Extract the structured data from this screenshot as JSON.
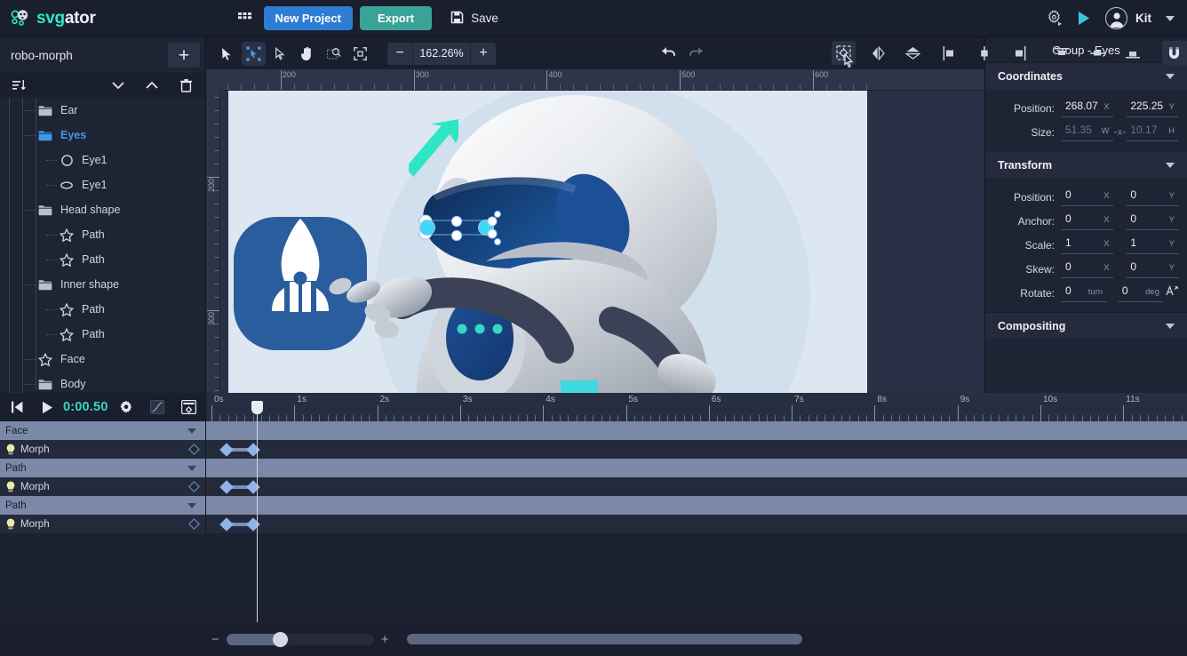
{
  "app": {
    "logo_first": "svg",
    "logo_second": "ator"
  },
  "header": {
    "grid_icon": "apps-grid-icon",
    "new_project_label": "New Project",
    "export_label": "Export",
    "save_label": "Save",
    "save_icon": "floppy-disk-icon",
    "settings_icon": "animation-settings-icon",
    "preview_icon": "play-preview-icon",
    "avatar_icon": "user-avatar-icon",
    "user_name": "Kit",
    "caret_icon": "chevron-down-icon"
  },
  "left_panel": {
    "project_name": "robo-morph",
    "add_label": "+",
    "tools": [
      {
        "name": "sort-layers-icon"
      },
      {
        "name": "collapse-down-icon"
      },
      {
        "name": "collapse-up-icon"
      },
      {
        "name": "delete-layer-icon"
      }
    ],
    "layers": [
      {
        "label": "Ear",
        "icon": "folder-icon",
        "depth": 2,
        "selected": false
      },
      {
        "label": "Eyes",
        "icon": "folder-icon",
        "depth": 2,
        "selected": true
      },
      {
        "label": "Eye1",
        "icon": "circle-icon",
        "depth": 3,
        "selected": false
      },
      {
        "label": "Eye1",
        "icon": "ellipse-icon",
        "depth": 3,
        "selected": false
      },
      {
        "label": "Head shape",
        "icon": "folder-icon",
        "depth": 2,
        "selected": false
      },
      {
        "label": "Path",
        "icon": "path-icon",
        "depth": 3,
        "selected": false
      },
      {
        "label": "Path",
        "icon": "path-icon",
        "depth": 3,
        "selected": false
      },
      {
        "label": "Inner shape",
        "icon": "folder-icon",
        "depth": 2,
        "selected": false
      },
      {
        "label": "Path",
        "icon": "path-icon",
        "depth": 3,
        "selected": false
      },
      {
        "label": "Path",
        "icon": "path-icon",
        "depth": 3,
        "selected": false
      },
      {
        "label": "Face",
        "icon": "path-icon",
        "depth": 2,
        "selected": false
      },
      {
        "label": "Body",
        "icon": "folder-icon",
        "depth": 2,
        "selected": false
      }
    ]
  },
  "toolbar": {
    "tools": [
      {
        "name": "select-tool",
        "active": false
      },
      {
        "name": "node-edit-tool",
        "active": true
      },
      {
        "name": "direct-select-tool",
        "active": false
      },
      {
        "name": "hand-tool",
        "active": false
      },
      {
        "name": "zoom-tool",
        "active": false
      },
      {
        "name": "fit-to-screen-tool",
        "active": false
      }
    ],
    "zoom_minus": "−",
    "zoom_value": "162.26%",
    "zoom_plus": "+",
    "undo_icon": "undo-icon",
    "redo_icon": "redo-icon",
    "right_tools": [
      {
        "name": "transform-center-icon",
        "active": true,
        "hover": true
      },
      {
        "name": "flip-horizontal-icon",
        "active": false
      },
      {
        "name": "flip-vertical-icon",
        "active": false
      },
      {
        "name": "align-left-icon",
        "active": false
      },
      {
        "name": "align-center-h-icon",
        "active": false
      },
      {
        "name": "align-right-icon",
        "active": false
      },
      {
        "name": "align-top-icon",
        "active": false
      },
      {
        "name": "align-middle-v-icon",
        "active": false
      },
      {
        "name": "align-bottom-icon",
        "active": false
      }
    ],
    "snap_icon": "magnet-snap-icon",
    "grid_icon": "grid-icon",
    "guides_icon": "guides-icon",
    "dropdown_icon": "chevron-down-icon"
  },
  "canvas": {
    "ruler_h_labels": [
      "200",
      "300",
      "400",
      "500",
      "600"
    ],
    "ruler_v_labels": [
      "200",
      "300"
    ],
    "cursor_icon": "arrow-pointer-annotation"
  },
  "properties": {
    "title": "Group - Eyes",
    "sections": [
      {
        "name": "Coordinates",
        "label": "Coordinates"
      },
      {
        "name": "Transform",
        "label": "Transform"
      },
      {
        "name": "Compositing",
        "label": "Compositing"
      }
    ],
    "coordinates": {
      "position_label": "Position:",
      "position_x": "268.07",
      "position_x_unit": "X",
      "position_y": "225.25",
      "position_y_unit": "Y",
      "size_label": "Size:",
      "size_w": "51.35",
      "size_w_unit": "W",
      "size_h": "10.17",
      "size_h_unit": "H",
      "link_icon": "link-ratio-icon"
    },
    "transform": {
      "rows": [
        {
          "label": "Position:",
          "x": "0",
          "xunit": "X",
          "y": "0",
          "yunit": "Y"
        },
        {
          "label": "Anchor:",
          "x": "0",
          "xunit": "X",
          "y": "0",
          "yunit": "Y"
        },
        {
          "label": "Scale:",
          "x": "1",
          "xunit": "X",
          "y": "1",
          "yunit": "Y"
        },
        {
          "label": "Skew:",
          "x": "0",
          "xunit": "X",
          "y": "0",
          "yunit": "Y"
        },
        {
          "label": "Rotate:",
          "x": "0",
          "xunit": "turn",
          "y": "0",
          "yunit": "deg"
        }
      ],
      "rotate_icon": "rotate-direction-icon"
    }
  },
  "timeline": {
    "controls": {
      "rewind_icon": "skip-to-start-icon",
      "play_icon": "play-icon",
      "time": "0:00.50",
      "settings_icon": "gear-icon",
      "easing_icon": "easing-curve-icon",
      "keyframe_options_icon": "keyframe-options-icon"
    },
    "ruler_labels": [
      "0s",
      "1s",
      "2s",
      "3s",
      "4s",
      "5s",
      "6s",
      "7s",
      "8s",
      "9s",
      "10s",
      "11s"
    ],
    "rows": [
      {
        "type": "group",
        "label": "Face"
      },
      {
        "type": "prop",
        "label": "Morph",
        "keyframes": [
          0.18,
          0.5
        ],
        "icon": "lightbulb-icon"
      },
      {
        "type": "group",
        "label": "Path"
      },
      {
        "type": "prop",
        "label": "Morph",
        "keyframes": [
          0.18,
          0.5
        ],
        "icon": "lightbulb-icon"
      },
      {
        "type": "group",
        "label": "Path"
      },
      {
        "type": "prop",
        "label": "Morph",
        "keyframes": [
          0.18,
          0.5
        ],
        "icon": "lightbulb-icon"
      }
    ],
    "playhead_time": "0:00.50",
    "zoom_minus": "−",
    "zoom_plus": "+"
  },
  "colors": {
    "accent_blue": "#2d7dd2",
    "accent_teal": "#3aa397",
    "logo_teal": "#2ee6c5",
    "time_teal": "#35d6c3",
    "keyframe_blue": "#8fb4e8",
    "group_row": "#7c88a8",
    "panel_bg": "#1e2434",
    "canvas_bg": "#2a3147"
  }
}
